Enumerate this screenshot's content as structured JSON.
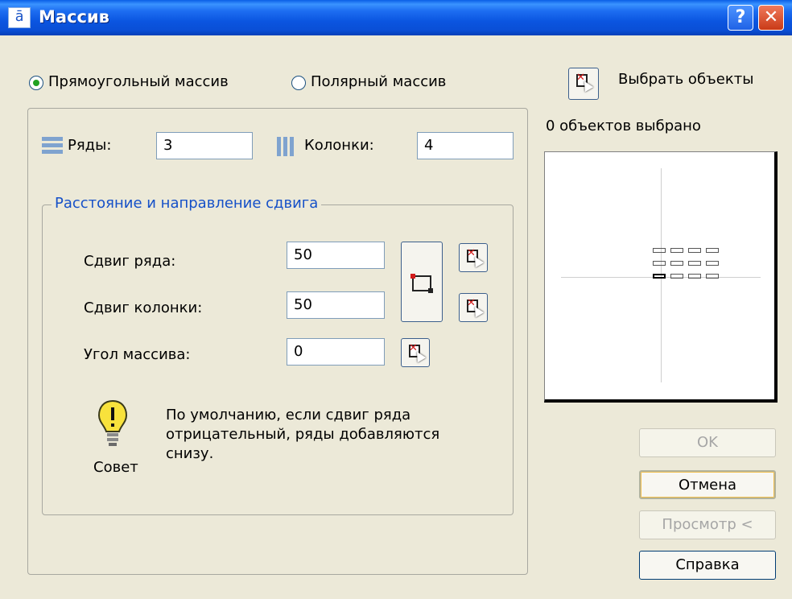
{
  "window": {
    "title": "Массив",
    "help_glyph": "?",
    "close_glyph": "✕"
  },
  "mode": {
    "rect_label": "Прямоугольный массив",
    "polar_label": "Полярный массив",
    "selected": "rect"
  },
  "select_objects": {
    "label": "Выбрать объекты",
    "count_text": "0 объектов выбрано"
  },
  "rows": {
    "label": "Ряды:",
    "value": "3"
  },
  "columns": {
    "label": "Колонки:",
    "value": "4"
  },
  "offset_group": {
    "title": "Расстояние и направление сдвига",
    "row_offset_label": "Сдвиг ряда:",
    "row_offset_value": "50",
    "col_offset_label": "Сдвиг колонки:",
    "col_offset_value": "50",
    "angle_label": "Угол массива:",
    "angle_value": "0"
  },
  "tip": {
    "caption": "Совет",
    "text": "По умолчанию, если сдвиг ряда отрицательный, ряды добавляются снизу."
  },
  "buttons": {
    "ok": "OK",
    "cancel": "Отмена",
    "preview": "Просмотр <",
    "help": "Справка"
  },
  "preview_grid": {
    "rows": 3,
    "cols": 4,
    "highlighted": "bottom-left"
  }
}
